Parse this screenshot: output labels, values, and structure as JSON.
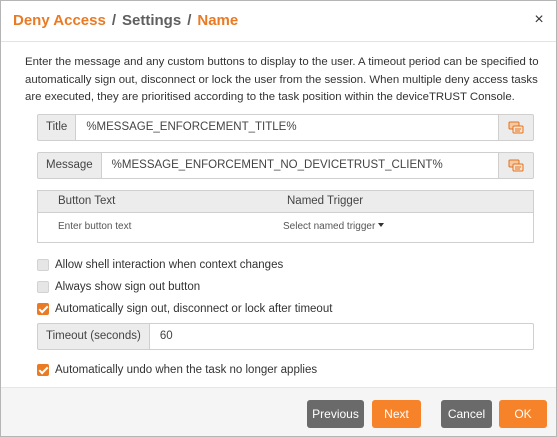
{
  "header": {
    "crumb1": "Deny Access",
    "sep1": "/",
    "crumb2": "Settings",
    "sep2": "/",
    "crumb3": "Name",
    "close_glyph": "×"
  },
  "description": "Enter the message and any custom buttons to display to the user. A timeout period can be specified to automatically sign out, disconnect or lock the user from the session. When multiple deny access tasks are executed, they are prioritised according to the task position within the deviceTRUST Console.",
  "title_field": {
    "label": "Title",
    "value": "%MESSAGE_ENFORCEMENT_TITLE%"
  },
  "message_field": {
    "label": "Message",
    "value": "%MESSAGE_ENFORCEMENT_NO_DEVICETRUST_CLIENT%"
  },
  "buttons_table": {
    "col_button_text": "Button Text",
    "col_named_trigger": "Named Trigger",
    "button_text_placeholder": "Enter button text",
    "named_trigger_placeholder": "Select named trigger"
  },
  "options": {
    "allow_shell": {
      "label": "Allow shell interaction when context changes",
      "checked": false
    },
    "always_show_signout": {
      "label": "Always show sign out button",
      "checked": false
    },
    "auto_signout": {
      "label": "Automatically sign out, disconnect or lock after timeout",
      "checked": true
    },
    "auto_undo": {
      "label": "Automatically undo when the task no longer applies",
      "checked": true
    }
  },
  "timeout_field": {
    "label": "Timeout (seconds)",
    "value": "60"
  },
  "footer": {
    "previous": "Previous",
    "next": "Next",
    "cancel": "Cancel",
    "ok": "OK"
  },
  "colors": {
    "accent": "#ea7a23",
    "button_orange": "#f6822a",
    "button_gray": "#6a6a6a"
  },
  "icons": {
    "title_picker": "message-variable-icon",
    "message_picker": "message-variable-icon",
    "close": "close-icon",
    "dropdown": "caret-down-icon"
  }
}
